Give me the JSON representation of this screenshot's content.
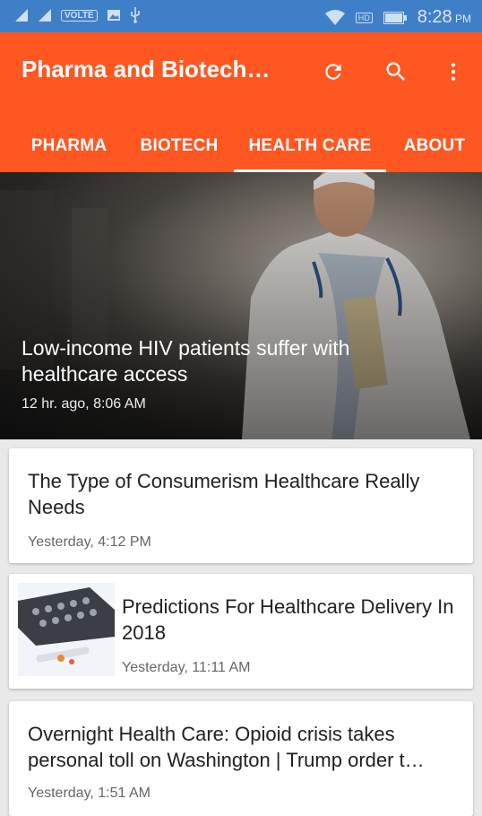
{
  "status_bar": {
    "volte_label": "VOLTE",
    "hd_label": "HD",
    "time": "8:28",
    "ampm": "PM"
  },
  "app_bar": {
    "title": "Pharma and Biotech…",
    "actions": [
      "refresh-icon",
      "search-icon",
      "more-vert-icon"
    ]
  },
  "tabs": [
    {
      "label": "PHARMA"
    },
    {
      "label": "BIOTECH"
    },
    {
      "label": "HEALTH CARE"
    },
    {
      "label": "ABOUT"
    }
  ],
  "active_tab": "HEALTH CARE",
  "hero": {
    "title": "Low-income HIV patients suffer with healthcare access",
    "time": "12 hr. ago, 8:06 AM"
  },
  "articles": [
    {
      "title": "The Type of Consumerism Healthcare Really Needs",
      "time": "Yesterday, 4:12 PM"
    },
    {
      "title": "Predictions For Healthcare Delivery In 2018",
      "time": "Yesterday, 11:11 AM"
    },
    {
      "title": "Overnight Health Care: Opioid crisis takes personal toll on Washington | Trump order t…",
      "time": "Yesterday, 1:51 AM"
    }
  ],
  "colors": {
    "status_bar": "#3f7fc7",
    "app_bar": "#ff5722",
    "background": "#e9e9e9"
  }
}
